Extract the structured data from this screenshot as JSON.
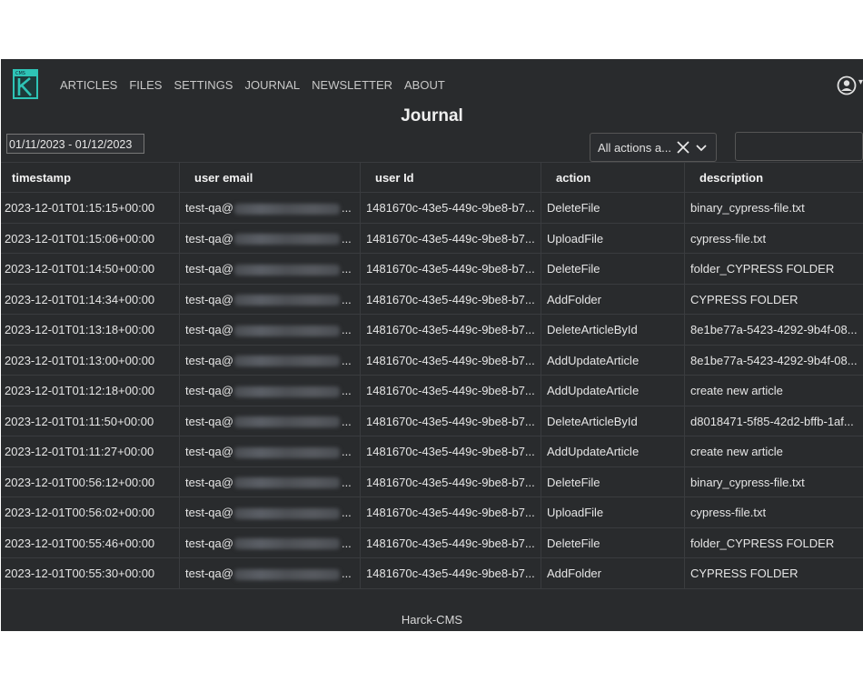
{
  "nav": {
    "logo_icon": "harck-cms-logo",
    "links": [
      "ARTICLES",
      "FILES",
      "SETTINGS",
      "JOURNAL",
      "NEWSLETTER",
      "ABOUT"
    ],
    "account_icon": "account-circle-icon"
  },
  "page": {
    "title": "Journal",
    "footer": "Harck-CMS"
  },
  "filters": {
    "date_range": "01/11/2023 - 01/12/2023",
    "action_select": "All actions a...",
    "search_value": ""
  },
  "table": {
    "headers": [
      "timestamp",
      "user email",
      "user Id",
      "action",
      "description"
    ],
    "rows": [
      [
        "2023-12-01T01:15:15+00:00",
        "test-qa@",
        "1481670c-43e5-449c-9be8-b7...",
        "DeleteFile",
        "binary_cypress-file.txt"
      ],
      [
        "2023-12-01T01:15:06+00:00",
        "test-qa@",
        "1481670c-43e5-449c-9be8-b7...",
        "UploadFile",
        "cypress-file.txt"
      ],
      [
        "2023-12-01T01:14:50+00:00",
        "test-qa@",
        "1481670c-43e5-449c-9be8-b7...",
        "DeleteFile",
        "folder_CYPRESS FOLDER"
      ],
      [
        "2023-12-01T01:14:34+00:00",
        "test-qa@",
        "1481670c-43e5-449c-9be8-b7...",
        "AddFolder",
        "CYPRESS FOLDER"
      ],
      [
        "2023-12-01T01:13:18+00:00",
        "test-qa@",
        "1481670c-43e5-449c-9be8-b7...",
        "DeleteArticleById",
        "8e1be77a-5423-4292-9b4f-08..."
      ],
      [
        "2023-12-01T01:13:00+00:00",
        "test-qa@",
        "1481670c-43e5-449c-9be8-b7...",
        "AddUpdateArticle",
        "8e1be77a-5423-4292-9b4f-08..."
      ],
      [
        "2023-12-01T01:12:18+00:00",
        "test-qa@",
        "1481670c-43e5-449c-9be8-b7...",
        "AddUpdateArticle",
        "create new article"
      ],
      [
        "2023-12-01T01:11:50+00:00",
        "test-qa@",
        "1481670c-43e5-449c-9be8-b7...",
        "DeleteArticleById",
        "d8018471-5f85-42d2-bffb-1af..."
      ],
      [
        "2023-12-01T01:11:27+00:00",
        "test-qa@",
        "1481670c-43e5-449c-9be8-b7...",
        "AddUpdateArticle",
        "create new article"
      ],
      [
        "2023-12-01T00:56:12+00:00",
        "test-qa@",
        "1481670c-43e5-449c-9be8-b7...",
        "DeleteFile",
        "binary_cypress-file.txt"
      ],
      [
        "2023-12-01T00:56:02+00:00",
        "test-qa@",
        "1481670c-43e5-449c-9be8-b7...",
        "UploadFile",
        "cypress-file.txt"
      ],
      [
        "2023-12-01T00:55:46+00:00",
        "test-qa@",
        "1481670c-43e5-449c-9be8-b7...",
        "DeleteFile",
        "folder_CYPRESS FOLDER"
      ],
      [
        "2023-12-01T00:55:30+00:00",
        "test-qa@",
        "1481670c-43e5-449c-9be8-b7...",
        "AddFolder",
        "CYPRESS FOLDER"
      ]
    ],
    "email_ellipsis": "..."
  },
  "colors": {
    "background": "#292b2d",
    "logo_accent": "#2ec4b6",
    "text": "#e6e6e6"
  }
}
